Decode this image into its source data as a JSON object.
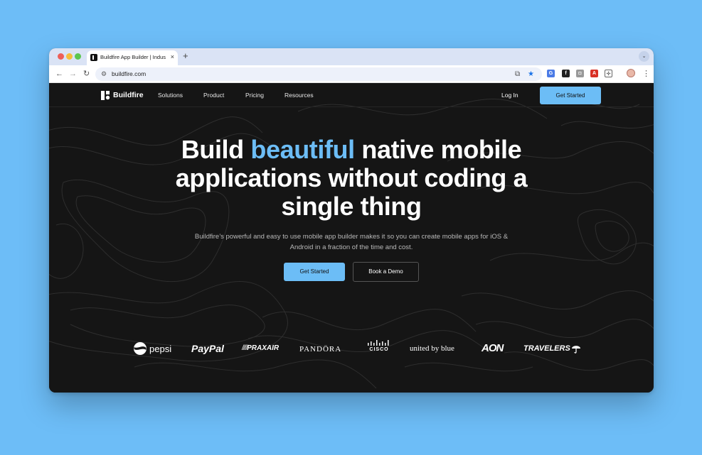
{
  "colors": {
    "background": "#6dbdf7",
    "page_bg": "#151515",
    "accent": "#6cbdf6",
    "tabstrip": "#dae3f5"
  },
  "browser": {
    "tab_title": "Buildfire App Builder | Indust",
    "tab_close": "×",
    "new_tab": "+",
    "tab_menu": "⌄",
    "back": "←",
    "forward": "→",
    "reload": "↻",
    "url": "buildfire.com",
    "menu": "⋮",
    "icons": [
      "tune-icon",
      "translate-icon",
      "star-icon",
      "extension-icons",
      "puzzle-icon",
      "profile-avatar"
    ]
  },
  "nav": {
    "logo_text": "Buildfire",
    "links": [
      "Solutions",
      "Product",
      "Pricing",
      "Resources"
    ],
    "login": "Log In",
    "cta": "Get Started"
  },
  "hero": {
    "title_before": "Build ",
    "title_accent": "beautiful",
    "title_after": " native mobile applications without coding a single thing",
    "subtitle": "Buildfire’s powerful and easy to use mobile app builder makes it so you can create mobile apps for iOS & Android in a fraction of the time and cost.",
    "primary_button": "Get Started",
    "secondary_button": "Book a Demo"
  },
  "logos": [
    "pepsi",
    "PayPal",
    "PRAXAIR",
    "PANDÖRA",
    "CISCO",
    "united by blue",
    "AON",
    "TRAVELERS"
  ]
}
